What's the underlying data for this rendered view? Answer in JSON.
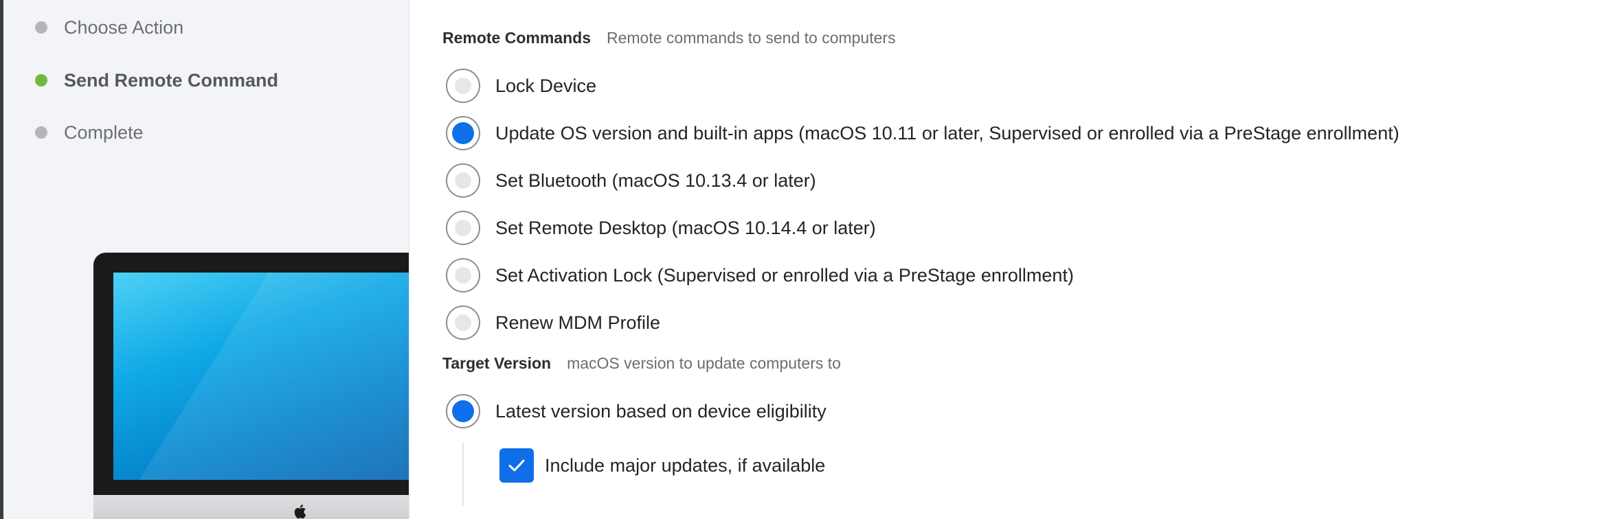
{
  "wizard": {
    "steps": [
      {
        "label": "Choose Action",
        "state": "done"
      },
      {
        "label": "Send Remote Command",
        "state": "active"
      },
      {
        "label": "Complete",
        "state": "pending"
      }
    ]
  },
  "remote_commands": {
    "title": "Remote Commands",
    "description": "Remote commands to send to computers",
    "options": [
      {
        "label": "Lock Device",
        "selected": false
      },
      {
        "label": "Update OS version and built-in apps (macOS 10.11 or later, Supervised or enrolled via a PreStage enrollment)",
        "selected": true
      },
      {
        "label": "Set Bluetooth (macOS 10.13.4 or later)",
        "selected": false
      },
      {
        "label": "Set Remote Desktop (macOS 10.14.4 or later)",
        "selected": false
      },
      {
        "label": "Set Activation Lock (Supervised or enrolled via a PreStage enrollment)",
        "selected": false
      },
      {
        "label": "Renew MDM Profile",
        "selected": false
      }
    ]
  },
  "target_version": {
    "title": "Target Version",
    "description": "macOS version to update computers to",
    "options": [
      {
        "label": "Latest version based on device eligibility",
        "selected": true
      }
    ],
    "include_major_updates": {
      "label": "Include major updates, if available",
      "checked": true
    }
  },
  "colors": {
    "accent": "#0f6fe8",
    "step_active": "#76b83f",
    "step_inactive": "#b3b5ba",
    "sidebar_bg": "#f3f4f8"
  },
  "icons": {
    "illustration": "imac-illustration",
    "apple": "apple-logo-icon",
    "check": "checkmark-icon"
  }
}
